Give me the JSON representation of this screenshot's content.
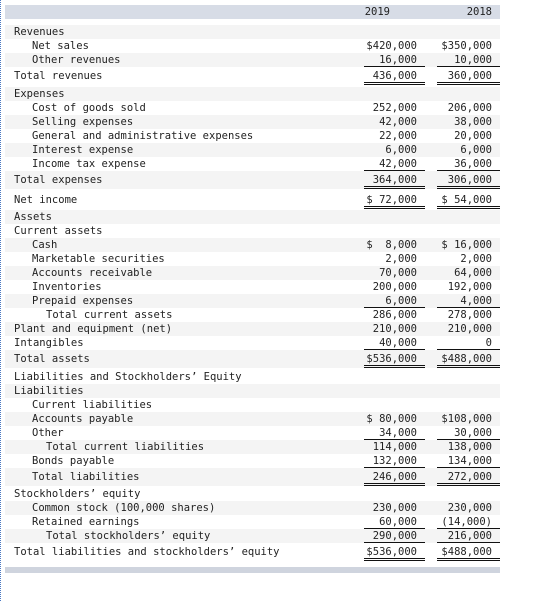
{
  "header": {
    "col_2019": "2019",
    "col_2018": "2018"
  },
  "rows": [
    {
      "label": "Revenues",
      "indent": 0,
      "v2019": "",
      "v2018": ""
    },
    {
      "label": "Net sales",
      "indent": 1,
      "v2019": "$420,000",
      "v2018": "$350,000"
    },
    {
      "label": "Other revenues",
      "indent": 1,
      "v2019": "16,000",
      "v2018": "10,000"
    },
    {
      "label": "Total revenues",
      "indent": 0,
      "v2019": "436,000",
      "v2018": "360,000"
    },
    {
      "label": "Expenses",
      "indent": 0,
      "v2019": "",
      "v2018": ""
    },
    {
      "label": "Cost of goods sold",
      "indent": 1,
      "v2019": "252,000",
      "v2018": "206,000"
    },
    {
      "label": "Selling expenses",
      "indent": 1,
      "v2019": "42,000",
      "v2018": "38,000"
    },
    {
      "label": "General and administrative expenses",
      "indent": 1,
      "v2019": "22,000",
      "v2018": "20,000"
    },
    {
      "label": "Interest expense",
      "indent": 1,
      "v2019": "6,000",
      "v2018": "6,000"
    },
    {
      "label": "Income tax expense",
      "indent": 1,
      "v2019": "42,000",
      "v2018": "36,000"
    },
    {
      "label": "Total expenses",
      "indent": 0,
      "v2019": "364,000",
      "v2018": "306,000"
    },
    {
      "label": "Net income",
      "indent": 0,
      "v2019": "$ 72,000",
      "v2018": "$ 54,000"
    },
    {
      "label": "Assets",
      "indent": 0,
      "v2019": "",
      "v2018": ""
    },
    {
      "label": "Current assets",
      "indent": 0,
      "v2019": "",
      "v2018": ""
    },
    {
      "label": "Cash",
      "indent": 1,
      "v2019": "$  8,000",
      "v2018": "$ 16,000"
    },
    {
      "label": "Marketable securities",
      "indent": 1,
      "v2019": "2,000",
      "v2018": "2,000"
    },
    {
      "label": "Accounts receivable",
      "indent": 1,
      "v2019": "70,000",
      "v2018": "64,000"
    },
    {
      "label": "Inventories",
      "indent": 1,
      "v2019": "200,000",
      "v2018": "192,000"
    },
    {
      "label": "Prepaid expenses",
      "indent": 1,
      "v2019": "6,000",
      "v2018": "4,000"
    },
    {
      "label": "Total current assets",
      "indent": 2,
      "v2019": "286,000",
      "v2018": "278,000"
    },
    {
      "label": "Plant and equipment (net)",
      "indent": 0,
      "v2019": "210,000",
      "v2018": "210,000"
    },
    {
      "label": "Intangibles",
      "indent": 0,
      "v2019": "40,000",
      "v2018": "0"
    },
    {
      "label": "Total assets",
      "indent": 0,
      "v2019": "$536,000",
      "v2018": "$488,000"
    },
    {
      "label": "Liabilities and Stockholders’ Equity",
      "indent": 0,
      "v2019": "",
      "v2018": ""
    },
    {
      "label": "Liabilities",
      "indent": 0,
      "v2019": "",
      "v2018": ""
    },
    {
      "label": "Current liabilities",
      "indent": 1,
      "v2019": "",
      "v2018": ""
    },
    {
      "label": "Accounts payable",
      "indent": 1,
      "v2019": "$ 80,000",
      "v2018": "$108,000"
    },
    {
      "label": "Other",
      "indent": 1,
      "v2019": "34,000",
      "v2018": "30,000"
    },
    {
      "label": "Total current liabilities",
      "indent": 2,
      "v2019": "114,000",
      "v2018": "138,000"
    },
    {
      "label": "Bonds payable",
      "indent": 1,
      "v2019": "132,000",
      "v2018": "134,000"
    },
    {
      "label": "Total liabilities",
      "indent": 1,
      "v2019": "246,000",
      "v2018": "272,000"
    },
    {
      "label": "Stockholders’ equity",
      "indent": 0,
      "v2019": "",
      "v2018": ""
    },
    {
      "label": "Common stock (100,000 shares)",
      "indent": 1,
      "v2019": "230,000",
      "v2018": "230,000"
    },
    {
      "label": "Retained earnings",
      "indent": 1,
      "v2019": "60,000",
      "v2018": "(14,000)"
    },
    {
      "label": "Total stockholders’ equity",
      "indent": 2,
      "v2019": "290,000",
      "v2018": "216,000"
    },
    {
      "label": "Total liabilities and stockholders’ equity",
      "indent": 0,
      "v2019": "$536,000",
      "v2018": "$488,000"
    }
  ]
}
